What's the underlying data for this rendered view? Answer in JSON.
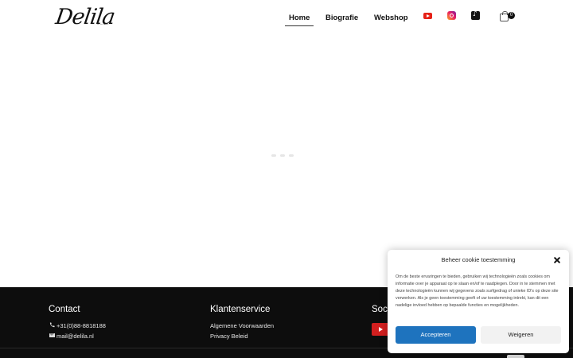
{
  "header": {
    "logo_text": "Delila",
    "logo_sub": "────",
    "nav": [
      {
        "label": "Home",
        "active": true
      },
      {
        "label": "Biografie",
        "active": false
      },
      {
        "label": "Webshop",
        "active": false
      }
    ],
    "social_icons": [
      "youtube-icon",
      "instagram-icon",
      "tiktok-icon"
    ],
    "cart_count": "0"
  },
  "footer": {
    "contact": {
      "title": "Contact",
      "phone": "+31(0)88-8818188",
      "email": "mail@delila.nl"
    },
    "service": {
      "title": "Klantenservice",
      "links": [
        "Algemene Voorwaarden",
        "Privacy Beleid"
      ]
    },
    "social": {
      "title": "Soc"
    }
  },
  "cookie": {
    "title": "Beheer cookie toestemming",
    "text": "Om de beste ervaringen te bieden, gebruiken wij technologieën zoals cookies om informatie over je apparaat op te slaan en/of te raadplegen. Door in te stemmen met deze technologieën kunnen wij gegevens zoals surfgedrag of unieke ID's op deze site verwerken. Als je geen toestemming geeft of uw toestemming intrekt, kan dit een nadelige invloed hebben op bepaalde functies en mogelijkheden.",
    "accept_label": "Accepteren",
    "deny_label": "Weigeren"
  },
  "colors": {
    "accent": "#1e73be",
    "footer_bg": "#0d0d0d",
    "youtube": "#e62117"
  }
}
